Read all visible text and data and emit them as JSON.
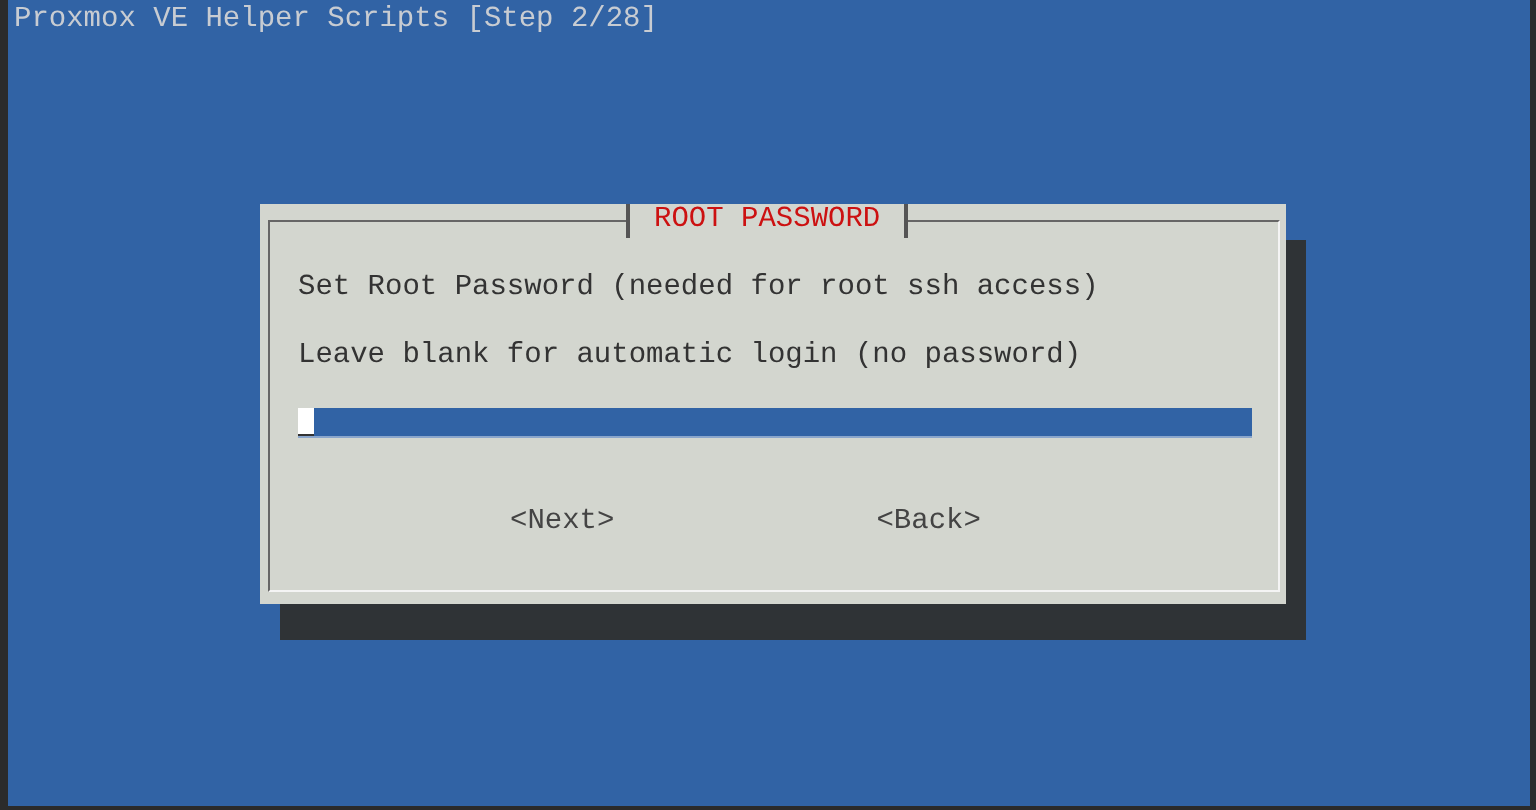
{
  "screen": {
    "title": "Proxmox VE Helper Scripts [Step 2/28]"
  },
  "dialog": {
    "title": "ROOT PASSWORD",
    "lines": [
      "Set Root Password (needed for root ssh access)",
      "Leave blank for automatic login (no password)"
    ],
    "buttons": [
      {
        "label": "<Next>"
      },
      {
        "label": "<Back>"
      }
    ]
  }
}
